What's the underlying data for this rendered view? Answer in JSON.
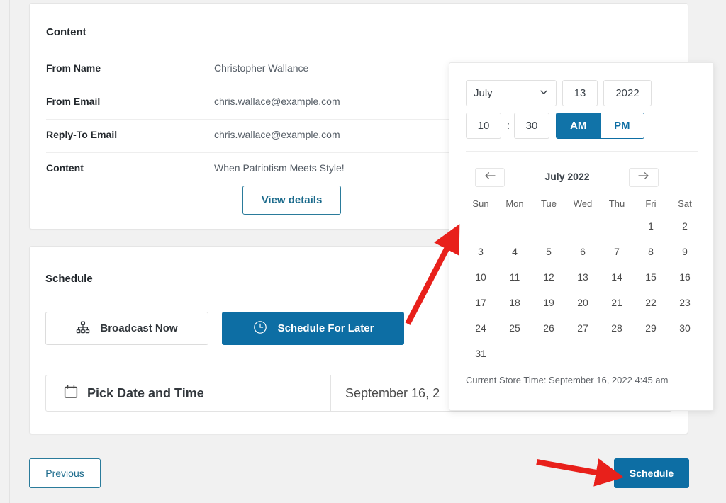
{
  "content_card": {
    "title": "Content",
    "rows": [
      {
        "label": "From Name",
        "value": "Christopher Wallance"
      },
      {
        "label": "From Email",
        "value": "chris.wallace@example.com"
      },
      {
        "label": "Reply-To Email",
        "value": "chris.wallace@example.com"
      },
      {
        "label": "Content",
        "value": "When Patriotism Meets Style!"
      }
    ],
    "view_details_label": "View details"
  },
  "schedule_card": {
    "title": "Schedule",
    "broadcast_now_label": "Broadcast Now",
    "schedule_later_label": "Schedule For Later",
    "active_mode": "Schedule For Later",
    "pick_label": "Pick Date and Time",
    "pick_value": "September 16, 2"
  },
  "footer": {
    "previous_label": "Previous",
    "schedule_label": "Schedule"
  },
  "datetime_picker": {
    "month": "July",
    "day": "13",
    "year": "2022",
    "hour": "10",
    "colon": ":",
    "minute": "30",
    "am_label": "AM",
    "pm_label": "PM",
    "meridiem_selected": "AM",
    "calendar_title": "July 2022",
    "prev_arrow": "←",
    "next_arrow": "→",
    "day_names": [
      "Sun",
      "Mon",
      "Tue",
      "Wed",
      "Thu",
      "Fri",
      "Sat"
    ],
    "leading_blanks": 5,
    "days": [
      1,
      2,
      3,
      4,
      5,
      6,
      7,
      8,
      9,
      10,
      11,
      12,
      13,
      14,
      15,
      16,
      17,
      18,
      19,
      20,
      21,
      22,
      23,
      24,
      25,
      26,
      27,
      28,
      29,
      30,
      31
    ],
    "store_time_text": "Current Store Time: September 16, 2022 4:45 am"
  },
  "colors": {
    "primary_blue": "#0d6ea4",
    "toggle_blue": "#1173a8",
    "outline_teal": "#2a7b9b",
    "annotation_red": "#e8201b",
    "page_background": "#f1f1f1",
    "card_background": "#ffffff"
  }
}
